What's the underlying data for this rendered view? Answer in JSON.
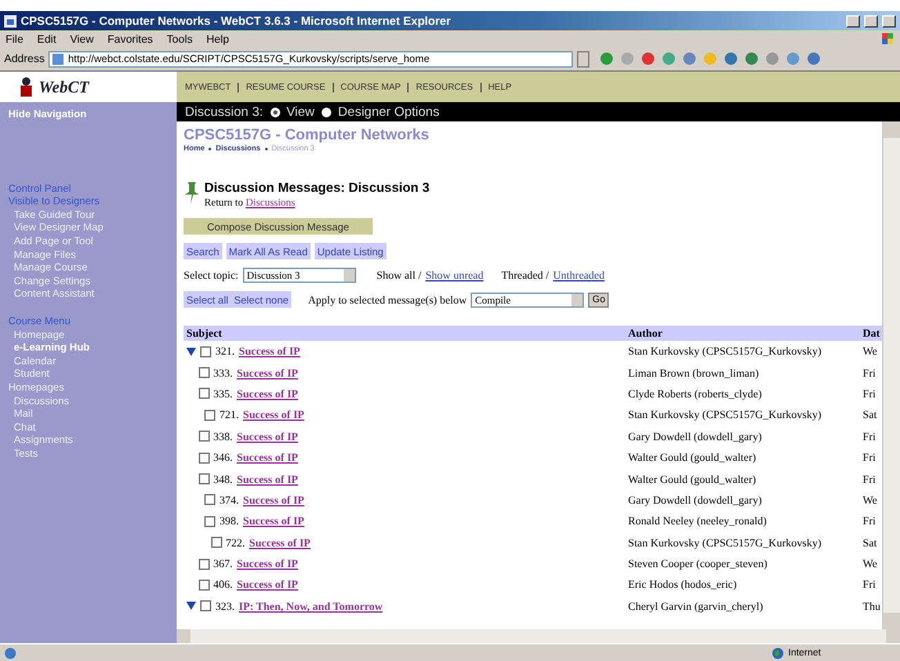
{
  "window": {
    "title": "CPSC5157G - Computer Networks - WebCT 3.6.3 - Microsoft Internet Explorer"
  },
  "menu": [
    "File",
    "Edit",
    "View",
    "Favorites",
    "Tools",
    "Help"
  ],
  "address": {
    "label": "Address",
    "url": "http://webct.colstate.edu/SCRIPT/CPSC5157G_Kurkovsky/scripts/serve_home"
  },
  "logo": "WebCT",
  "nav_links": [
    "MYWEBCT",
    "RESUME COURSE",
    "COURSE MAP",
    "RESOURCES",
    "HELP"
  ],
  "mode_bar": {
    "label": "Discussion 3:",
    "options": [
      {
        "label": "View",
        "selected": true
      },
      {
        "label": "Designer Options",
        "selected": false
      }
    ]
  },
  "sidebar": {
    "items": [
      {
        "label": "Hide Navigation",
        "kind": "toggle"
      },
      {
        "label": "Control Panel",
        "kind": "heading"
      },
      {
        "label": "Visible to Designers",
        "kind": "heading"
      },
      {
        "label": "Take Guided Tour",
        "kind": "item"
      },
      {
        "label": "View Designer Map",
        "kind": "item"
      },
      {
        "label": "Add Page or Tool",
        "kind": "item"
      },
      {
        "label": "Manage Files",
        "kind": "item"
      },
      {
        "label": "Manage Course",
        "kind": "item"
      },
      {
        "label": "Change Settings",
        "kind": "item"
      },
      {
        "label": "Content Assistant",
        "kind": "item"
      },
      {
        "label": "Course Menu",
        "kind": "heading"
      },
      {
        "label": "Homepage",
        "kind": "item"
      },
      {
        "label": "e-Learning Hub",
        "kind": "current"
      },
      {
        "label": "Calendar",
        "kind": "item"
      },
      {
        "label": "Student",
        "kind": "item"
      },
      {
        "label": "Homepages",
        "kind": "continuation"
      },
      {
        "label": "Discussions",
        "kind": "item"
      },
      {
        "label": "Mail",
        "kind": "item"
      },
      {
        "label": "Chat",
        "kind": "item"
      },
      {
        "label": "Assignments",
        "kind": "item"
      },
      {
        "label": "Tests",
        "kind": "item"
      }
    ]
  },
  "course_title": "CPSC5157G - Computer Networks",
  "breadcrumb": [
    {
      "label": "Home",
      "current": false
    },
    {
      "label": "Discussions",
      "current": false
    },
    {
      "label": "Discussion 3",
      "current": true
    }
  ],
  "page_heading": "Discussion Messages: Discussion 3",
  "return_text": "Return to",
  "return_link": "Discussions",
  "compose_button": "Compose Discussion Message",
  "action_buttons": [
    "Search",
    "Mark All As Read",
    "Update Listing"
  ],
  "topic": {
    "label": "Select topic:",
    "value": "Discussion 3"
  },
  "show": {
    "text": "Show all /",
    "link": "Show unread"
  },
  "threading": {
    "text": "Threaded /",
    "link": "Unthreaded"
  },
  "select_buttons": [
    "Select all",
    "Select none"
  ],
  "apply": {
    "label": "Apply to selected message(s) below",
    "value": "Compile",
    "button": "Go"
  },
  "table": {
    "columns": [
      "Subject",
      "Author",
      "Dat"
    ],
    "rows": [
      {
        "number": "321.",
        "subject": "Success of IP",
        "author": "Stan Kurkovsky (CPSC5157G_Kurkovsky)",
        "date": "We",
        "checked": false,
        "expanded": true,
        "children": [
          {
            "number": "333.",
            "subject": "Success of IP",
            "author": "Liman Brown (brown_liman)",
            "date": "Fri",
            "checked": false
          },
          {
            "number": "335.",
            "subject": "Success of IP",
            "author": "Clyde Roberts (roberts_clyde)",
            "date": "Fri",
            "checked": false,
            "children": [
              {
                "number": "721.",
                "subject": "Success of IP",
                "author": "Stan Kurkovsky (CPSC5157G_Kurkovsky)",
                "date": "Sat",
                "checked": false
              }
            ]
          },
          {
            "number": "338.",
            "subject": "Success of IP",
            "author": "Gary Dowdell (dowdell_gary)",
            "date": "Fri",
            "checked": false
          },
          {
            "number": "346.",
            "subject": "Success of IP",
            "author": "Walter Gould (gould_walter)",
            "date": "Fri",
            "checked": false
          },
          {
            "number": "348.",
            "subject": "Success of IP",
            "author": "Walter Gould (gould_walter)",
            "date": "Fri",
            "checked": false,
            "children": [
              {
                "number": "374.",
                "subject": "Success of IP",
                "author": "Gary Dowdell (dowdell_gary)",
                "date": "We",
                "checked": false
              },
              {
                "number": "398.",
                "subject": "Success of IP",
                "author": "Ronald Neeley (neeley_ronald)",
                "date": "Fri",
                "checked": false,
                "children": [
                  {
                    "number": "722.",
                    "subject": "Success of IP",
                    "author": "Stan Kurkovsky (CPSC5157G_Kurkovsky)",
                    "date": "Sat",
                    "checked": false
                  }
                ]
              }
            ]
          },
          {
            "number": "367.",
            "subject": "Success of IP",
            "author": "Steven Cooper (cooper_steven)",
            "date": "We",
            "checked": false
          },
          {
            "number": "406.",
            "subject": "Success of IP",
            "author": "Eric Hodos (hodos_eric)",
            "date": "Fri",
            "checked": false
          }
        ]
      },
      {
        "number": "323.",
        "subject": "IP: Then, Now, and Tomorrow",
        "author": "Cheryl Garvin (garvin_cheryl)",
        "date": "Thu",
        "checked": false,
        "expanded": true
      }
    ]
  },
  "status_bar": {
    "zone": "Internet"
  }
}
